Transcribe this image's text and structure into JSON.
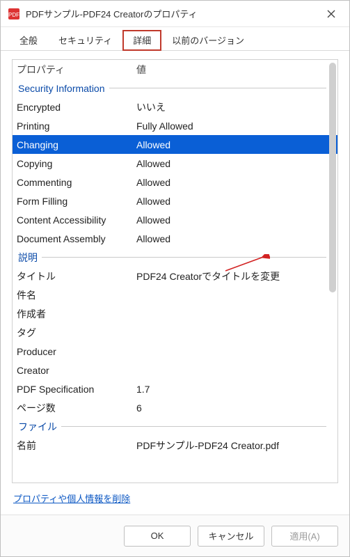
{
  "titlebar": {
    "title": "PDFサンプル-PDF24 Creatorのプロパティ"
  },
  "tabs": [
    {
      "label": "全般"
    },
    {
      "label": "セキュリティ"
    },
    {
      "label": "詳細",
      "active": true
    },
    {
      "label": "以前のバージョン"
    }
  ],
  "columns": {
    "property": "プロパティ",
    "value": "値"
  },
  "groups": {
    "group1_label": "Security Information",
    "group2_label": "説明",
    "group3_label": "ファイル"
  },
  "rows": {
    "r1": {
      "k": "Encrypted",
      "v": "いいえ"
    },
    "r2": {
      "k": "Printing",
      "v": "Fully Allowed"
    },
    "r3": {
      "k": "Changing",
      "v": "Allowed"
    },
    "r4": {
      "k": "Copying",
      "v": "Allowed"
    },
    "r5": {
      "k": "Commenting",
      "v": "Allowed"
    },
    "r6": {
      "k": "Form Filling",
      "v": "Allowed"
    },
    "r7": {
      "k": "Content Accessibility",
      "v": "Allowed"
    },
    "r8": {
      "k": "Document Assembly",
      "v": "Allowed"
    },
    "r9": {
      "k": "タイトル",
      "v": "PDF24 Creatorでタイトルを変更"
    },
    "r10": {
      "k": "件名",
      "v": ""
    },
    "r11": {
      "k": "作成者",
      "v": ""
    },
    "r12": {
      "k": "タグ",
      "v": ""
    },
    "r13": {
      "k": "Producer",
      "v": ""
    },
    "r14": {
      "k": "Creator",
      "v": ""
    },
    "r15": {
      "k": "PDF Specification",
      "v": "1.7"
    },
    "r16": {
      "k": "ページ数",
      "v": "6"
    },
    "r17": {
      "k": "名前",
      "v": "PDFサンプル-PDF24 Creator.pdf"
    }
  },
  "link": {
    "label": "プロパティや個人情報を削除"
  },
  "buttons": {
    "ok": "OK",
    "cancel": "キャンセル",
    "apply": "適用(A)"
  },
  "colors": {
    "selection": "#0a5fd6",
    "group_text": "#0a4aa8",
    "highlight_border": "#c0392b",
    "arrow": "#d22323"
  }
}
